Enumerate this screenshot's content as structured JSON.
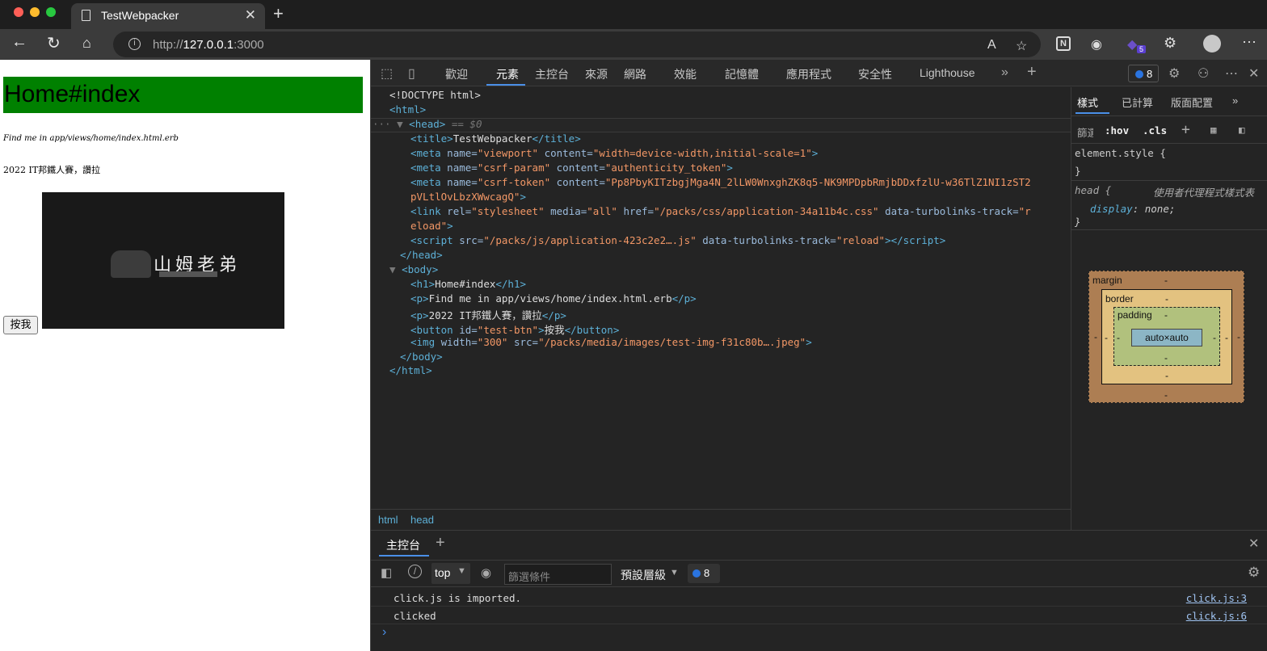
{
  "browser": {
    "tab_title": "TestWebpacker",
    "url_scheme": "http://",
    "url_host": "127.0.0.1",
    "url_port": ":3000",
    "extensions_badge": "5"
  },
  "page": {
    "heading": "Home#index",
    "p1": "Find me in app/views/home/index.html.erb",
    "p2": "2022 IT邦鐵人賽，讚拉",
    "button_label": "按我",
    "image_caption": "山姆老弟"
  },
  "devtools": {
    "tabs": [
      "歡迎",
      "元素",
      "主控台",
      "來源",
      "網路",
      "效能",
      "記憶體",
      "應用程式",
      "安全性",
      "Lighthouse"
    ],
    "issues_count": "8",
    "elements": {
      "doctype": "<!DOCTYPE html>",
      "html_open": "<html>",
      "head_open": "<head>",
      "selected_marker": "== $0",
      "title_text": "TestWebpacker",
      "meta_viewport_content": "\"width=device-width,initial-scale=1\"",
      "meta_csrf_param_content": "\"authenticity_token\"",
      "meta_csrf_token_content_1": "\"Pp8PbyKITzbgjMga4N_2lLW0WnxghZK8q5-NK9MPDpbRmjbDDxfzlU-w36TlZ1NI1zST2",
      "meta_csrf_token_content_2": "pVLtlOvLbzXWwcagQ\"",
      "link_href": "\"/packs/css/application-34a11b4c.css\"",
      "link_track_1": "\"r",
      "link_track_2": "eload\"",
      "script_src": "\"/packs/js/application-423c2e2….js\"",
      "script_track": "\"reload\"",
      "h1_text": "Home#index",
      "p1_text": "Find me in app/views/home/index.html.erb",
      "p2_text": "2022 IT邦鐵人賽，讚拉",
      "button_id": "\"test-btn\"",
      "button_text": "按我",
      "img_width": "\"300\"",
      "img_src": "\"/packs/media/images/test-img-f31c80b….jpeg\""
    },
    "breadcrumbs": [
      "html",
      "head"
    ],
    "styles": {
      "tabs": [
        "樣式",
        "已計算",
        "版面配置"
      ],
      "filter_label": "篩選",
      "hov": ":hov",
      "cls": ".cls",
      "element_style": "element.style {",
      "close_brace": "}",
      "head_selector": "head {",
      "ua_label": "使用者代理程式樣式表",
      "display_prop": "display",
      "display_val": "none;",
      "box_model": {
        "margin_label": "margin",
        "border_label": "border",
        "padding_label": "padding",
        "content": "auto×auto",
        "dash": "-"
      }
    },
    "console": {
      "tab_label": "主控台",
      "context": "top",
      "filter_placeholder": "篩選條件",
      "levels": "預設層級",
      "issues": "8",
      "messages": [
        {
          "text": "click.js is imported.",
          "source": "click.js:3"
        },
        {
          "text": "clicked",
          "source": "click.js:6"
        }
      ],
      "prompt": "›"
    }
  }
}
